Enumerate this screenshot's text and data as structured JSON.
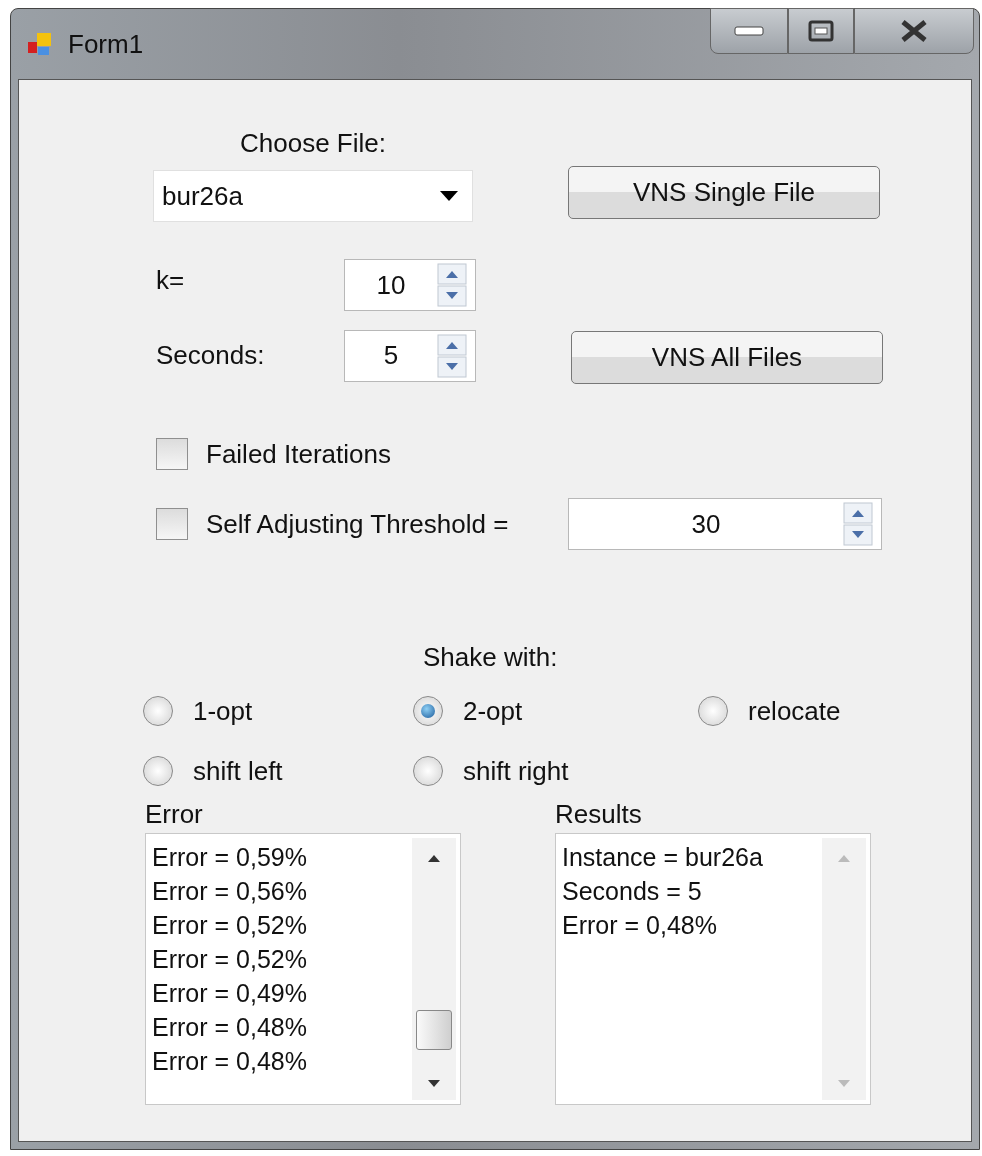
{
  "window": {
    "title": "Form1"
  },
  "choose_file": {
    "label": "Choose File:",
    "value": "bur26a"
  },
  "single_file_button": {
    "label": "VNS Single File"
  },
  "k": {
    "label": "k=",
    "value": "10"
  },
  "seconds": {
    "label": "Seconds:",
    "value": "5"
  },
  "all_files_button": {
    "label": "VNS All Files"
  },
  "failed_iterations": {
    "label": "Failed Iterations",
    "checked": false
  },
  "threshold": {
    "label": "Self Adjusting Threshold =",
    "checked": false,
    "value": "30"
  },
  "shake": {
    "label": "Shake with:",
    "options": [
      {
        "label": "1-opt",
        "selected": false
      },
      {
        "label": "2-opt",
        "selected": true
      },
      {
        "label": "relocate",
        "selected": false
      },
      {
        "label": "shift left",
        "selected": false
      },
      {
        "label": "shift right",
        "selected": false
      }
    ]
  },
  "lists": [
    {
      "label": "Error",
      "scrollable": true,
      "lines": [
        "Error = 0,59%",
        "Error = 0,56%",
        "Error = 0,52%",
        "Error = 0,52%",
        "Error = 0,49%",
        "Error = 0,48%",
        "Error = 0,48%"
      ]
    },
    {
      "label": "Results",
      "scrollable": false,
      "lines": [
        "Instance = bur26a",
        "Seconds = 5",
        "Error = 0,48%"
      ]
    }
  ]
}
